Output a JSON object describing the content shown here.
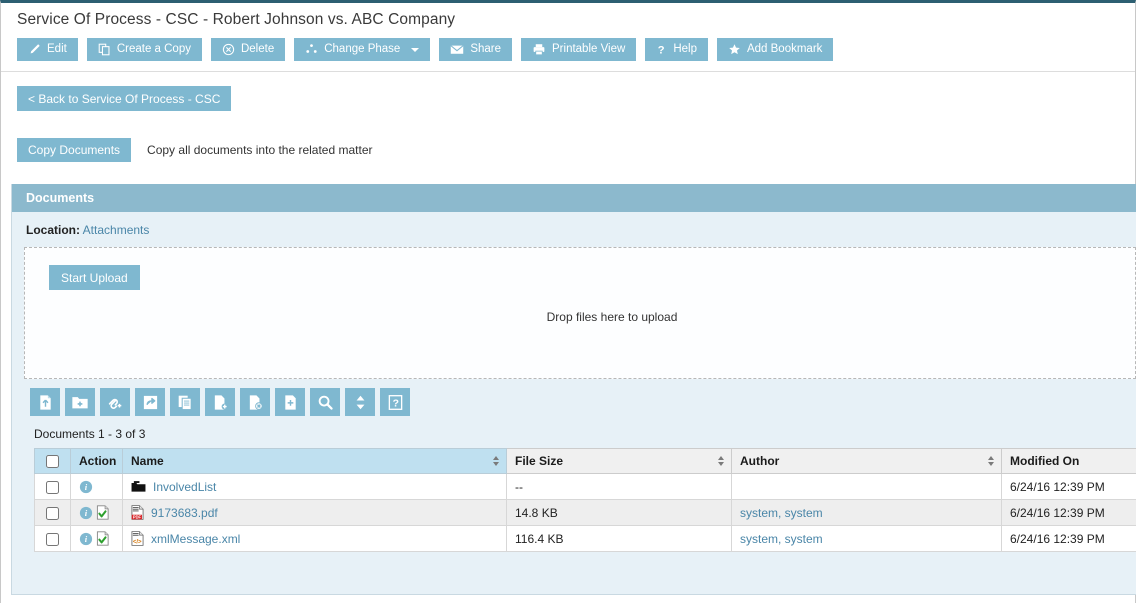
{
  "page_title": "Service Of Process - CSC - Robert Johnson vs. ABC Company",
  "colors": {
    "button_blue": "#7fb8d0",
    "panel_header_blue": "#8cb9cd",
    "panel_body_blue": "#e7f1f7",
    "table_header_blue": "#bfe0f0",
    "link_blue": "#4a86a8",
    "top_border": "#2d5f72"
  },
  "toolbar": {
    "buttons": [
      {
        "label": "Edit",
        "icon": "pencil-icon"
      },
      {
        "label": "Create a Copy",
        "icon": "copy-icon"
      },
      {
        "label": "Delete",
        "icon": "delete-circle-icon"
      },
      {
        "label": "Change Phase",
        "icon": "phase-icon",
        "caret": true
      },
      {
        "label": "Share",
        "icon": "envelope-icon"
      },
      {
        "label": "Printable View",
        "icon": "printer-icon"
      },
      {
        "label": "Help",
        "icon": "question-mark-icon"
      },
      {
        "label": "Add Bookmark",
        "icon": "star-icon"
      }
    ]
  },
  "back_button": {
    "label": "< Back to Service Of Process - CSC"
  },
  "copy_documents": {
    "button_label": "Copy Documents",
    "note": "Copy all documents into the related matter"
  },
  "documents_panel": {
    "header": "Documents",
    "location_label": "Location:",
    "location_value": "Attachments",
    "upload": {
      "start_upload_label": "Start Upload",
      "drop_text": "Drop files here to upload"
    },
    "icon_buttons": [
      {
        "name": "upload-document-icon",
        "title": "Upload Document"
      },
      {
        "name": "new-folder-icon",
        "title": "New Folder"
      },
      {
        "name": "add-link-icon",
        "title": "Add Link"
      },
      {
        "name": "move-document-icon",
        "title": "Move"
      },
      {
        "name": "copy-documents-icon",
        "title": "Copy"
      },
      {
        "name": "checkout-document-icon",
        "title": "Check Out"
      },
      {
        "name": "delete-document-icon",
        "title": "Delete"
      },
      {
        "name": "new-document-icon",
        "title": "New Document"
      },
      {
        "name": "search-icon",
        "title": "Search"
      },
      {
        "name": "sort-icon",
        "title": "Sort"
      },
      {
        "name": "help-icon",
        "title": "Help"
      }
    ],
    "count_line": "Documents 1 - 3 of 3",
    "table": {
      "columns": [
        {
          "label": "",
          "key": "checkbox",
          "sortable": false
        },
        {
          "label": "Action",
          "key": "action",
          "sortable": false
        },
        {
          "label": "Name",
          "key": "name",
          "sortable": true
        },
        {
          "label": "File Size",
          "key": "file_size",
          "sortable": true
        },
        {
          "label": "Author",
          "key": "author",
          "sortable": true
        },
        {
          "label": "Modified On",
          "key": "modified_on",
          "sortable": true
        }
      ],
      "rows": [
        {
          "checked": false,
          "actions": [
            "info-icon"
          ],
          "file_icon": "folder-icon",
          "name": "InvolvedList",
          "file_size": "--",
          "author": "",
          "modified_on": "6/24/16 12:39 PM"
        },
        {
          "checked": false,
          "actions": [
            "info-icon",
            "document-check-icon"
          ],
          "file_icon": "pdf-icon",
          "name": "9173683.pdf",
          "file_size": "14.8 KB",
          "author": "system, system",
          "modified_on": "6/24/16 12:39 PM"
        },
        {
          "checked": false,
          "actions": [
            "info-icon",
            "document-check-icon"
          ],
          "file_icon": "xml-icon",
          "name": "xmlMessage.xml",
          "file_size": "116.4 KB",
          "author": "system, system",
          "modified_on": "6/24/16 12:39 PM"
        }
      ]
    }
  }
}
